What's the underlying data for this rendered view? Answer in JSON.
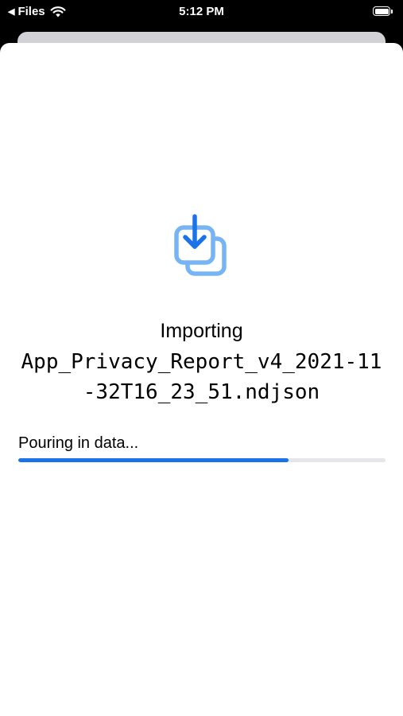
{
  "status_bar": {
    "back_app": "Files",
    "back_icon": "triangle-left-icon",
    "wifi_icon": "wifi-icon",
    "time": "5:12 PM",
    "battery_icon": "battery-full-icon"
  },
  "import": {
    "icon": "import-tray-arrow-icon",
    "title": "Importing",
    "file_name": "App_Privacy_Report_v4_2021-11-32T16_23_51.ndjson",
    "progress_label": "Pouring in data...",
    "progress_fraction": 0.735
  },
  "colors": {
    "accent": "#1a73e8",
    "accent_light": "#77b4f6",
    "track": "#e5e5ea",
    "sheet_behind": "#d1d1d6",
    "background": "#000000"
  }
}
